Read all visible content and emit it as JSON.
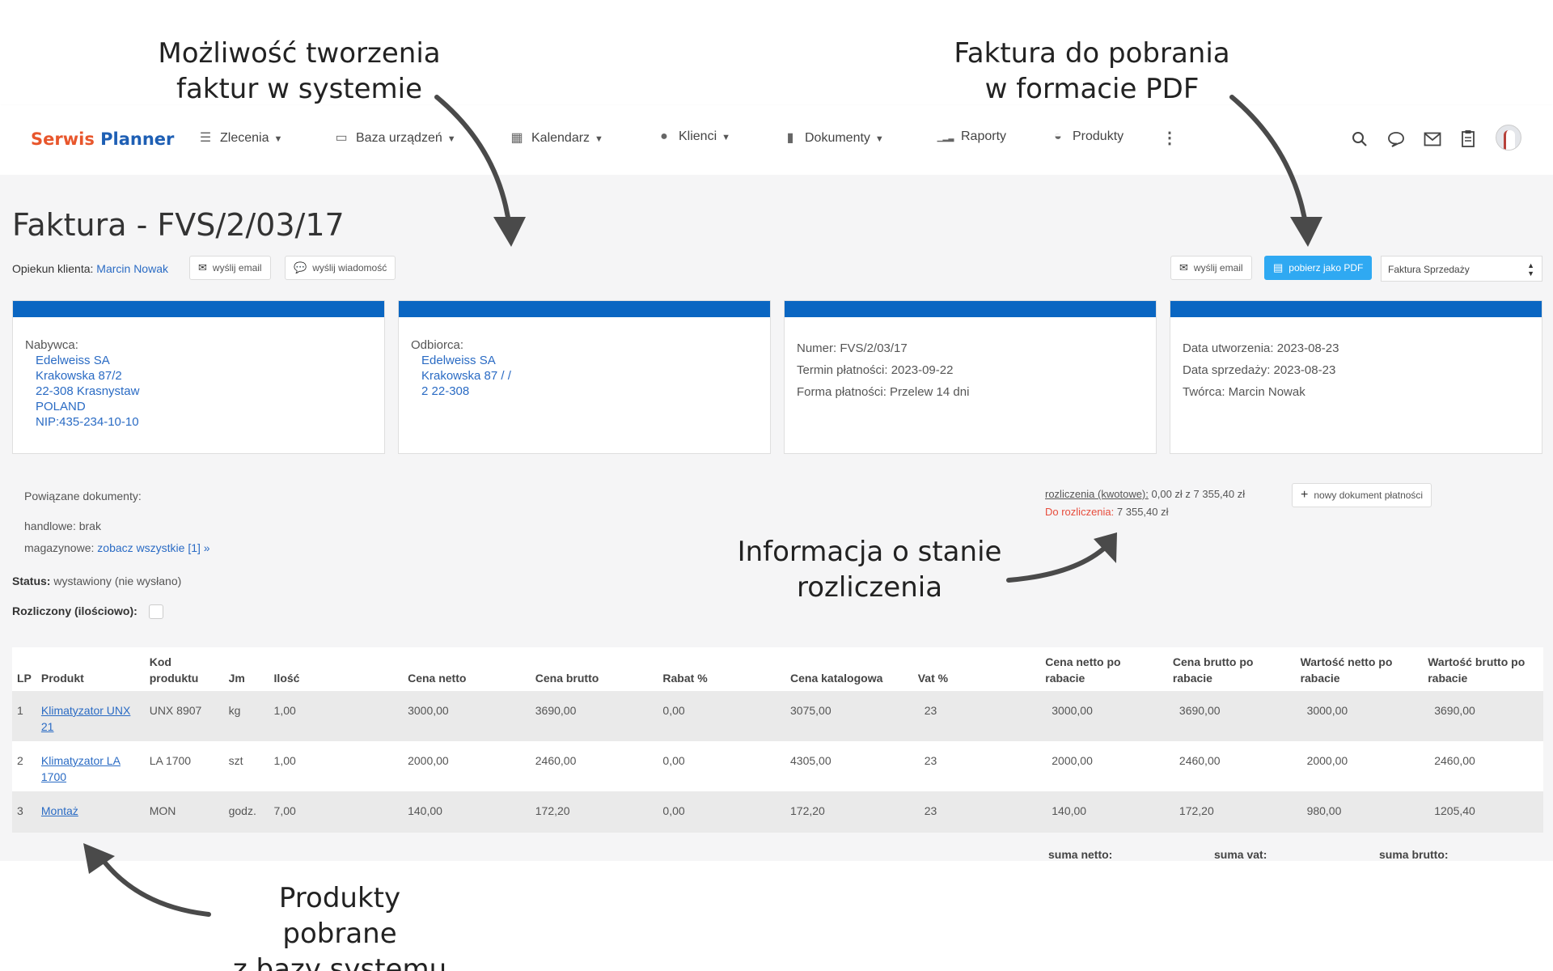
{
  "annotations": {
    "create": "Możliwość tworzenia\nfaktur w systemie",
    "pdf": "Faktura do pobrania\nw formacie PDF",
    "settlement": "Informacja o stanie\nrozliczenia",
    "products": "Produkty pobrane\nz bazy systemu"
  },
  "brand": {
    "part1": "Serwis",
    "part2": "Planner"
  },
  "nav": [
    {
      "label": "Zlecenia",
      "icon": "list-icon",
      "glyph": "☰",
      "dropdown": true
    },
    {
      "label": "Baza urządzeń",
      "icon": "device-icon",
      "glyph": "▭",
      "dropdown": true
    },
    {
      "label": "Kalendarz",
      "icon": "calendar-icon",
      "glyph": "▦",
      "dropdown": true
    },
    {
      "label": "Klienci",
      "icon": "person-icon",
      "glyph": "●",
      "dropdown": true
    },
    {
      "label": "Dokumenty",
      "icon": "document-icon",
      "glyph": "▮",
      "dropdown": true
    },
    {
      "label": "Raporty",
      "icon": "signal-icon",
      "glyph": "▁▂▃",
      "dropdown": false
    },
    {
      "label": "Produkty",
      "icon": "product-icon",
      "glyph": "◒",
      "dropdown": false
    }
  ],
  "page": {
    "title": "Faktura - FVS/2/03/17",
    "caretaker_label": "Opiekun klienta:",
    "caretaker_name": "Marcin Nowak",
    "send_email": "wyślij email",
    "send_message": "wyślij wiadomość",
    "download_pdf": "pobierz jako PDF",
    "doc_type": "Faktura Sprzedaży"
  },
  "cards": {
    "buyer": {
      "label": "Nabywca:",
      "lines": [
        "Edelweiss SA",
        "Krakowska 87/2",
        "22-308 Krasnystaw",
        "POLAND",
        "NIP:435-234-10-10"
      ]
    },
    "recipient": {
      "label": "Odbiorca:",
      "lines": [
        "Edelweiss SA",
        "Krakowska 87 / /",
        "2 22-308"
      ]
    },
    "payment": {
      "number": "Numer: FVS/2/03/17",
      "due": "Termin płatności: 2023-09-22",
      "method": "Forma płatności: Przelew 14 dni"
    },
    "dates": {
      "created": "Data utworzenia: 2023-08-23",
      "sale": "Data sprzedaży: 2023-08-23",
      "author": "Twórca: Marcin Nowak"
    }
  },
  "related": {
    "title": "Powiązane dokumenty:",
    "trade": "handlowe: brak",
    "warehouse_label": "magazynowe:",
    "warehouse_link": "zobacz wszystkie [1] »"
  },
  "settlement": {
    "link": "rozliczenia (kwotowe):",
    "amount": "0,00 zł z 7 355,40 zł",
    "due_label": "Do rozliczenia:",
    "due_value": "7 355,40 zł",
    "new_payment": "nowy dokument płatności"
  },
  "status": {
    "label": "Status:",
    "value": "wystawiony (nie wysłano)",
    "settled_label": "Rozliczony (ilościowo):"
  },
  "table": {
    "headers": [
      "LP",
      "Produkt",
      "Kod produktu",
      "Jm",
      "Ilość",
      "Cena netto",
      "Cena brutto",
      "Rabat %",
      "Cena katalogowa",
      "Vat %",
      "Cena netto po rabacie",
      "Cena brutto po rabacie",
      "Wartość netto po rabacie",
      "Wartość brutto po rabacie"
    ],
    "rows": [
      [
        "1",
        "Klimatyzator UNX 21",
        "UNX 8907",
        "kg",
        "1,00",
        "3000,00",
        "3690,00",
        "0,00",
        "3075,00",
        "23",
        "3000,00",
        "3690,00",
        "3000,00",
        "3690,00"
      ],
      [
        "2",
        "Klimatyzator LA 1700",
        "LA 1700",
        "szt",
        "1,00",
        "2000,00",
        "2460,00",
        "0,00",
        "4305,00",
        "23",
        "2000,00",
        "2460,00",
        "2000,00",
        "2460,00"
      ],
      [
        "3",
        "Montaż",
        "MON",
        "godz.",
        "7,00",
        "140,00",
        "172,20",
        "0,00",
        "172,20",
        "23",
        "140,00",
        "172,20",
        "980,00",
        "1205,40"
      ]
    ],
    "sum_net": "suma netto:",
    "sum_vat": "suma vat:",
    "sum_gross": "suma brutto:"
  },
  "colors": {
    "brand_orange": "#e8562c",
    "brand_blue": "#1e5fb4",
    "card_bar": "#0a66c2",
    "link": "#2a6bc4",
    "primary_button": "#2fa9f2",
    "alert_red": "#e74c3c"
  }
}
